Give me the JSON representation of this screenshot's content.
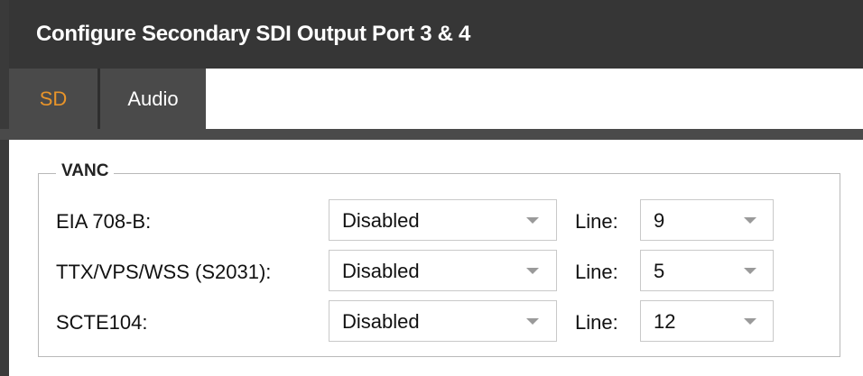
{
  "dialog": {
    "title": "Configure Secondary SDI Output Port 3 & 4"
  },
  "tabs": [
    {
      "label": "SD",
      "active": true
    },
    {
      "label": "Audio",
      "active": false
    }
  ],
  "vanc": {
    "legend": "VANC",
    "line_label": "Line:",
    "rows": [
      {
        "label": "EIA 708-B:",
        "mode": "Disabled",
        "line": "9"
      },
      {
        "label": "TTX/VPS/WSS (S2031):",
        "mode": "Disabled",
        "line": "5"
      },
      {
        "label": "SCTE104:",
        "mode": "Disabled",
        "line": "12"
      }
    ]
  },
  "icons": {
    "dropdown": "chevron-down-icon"
  },
  "colors": {
    "title_bar": "#363636",
    "tab_bg": "#4a4a4a",
    "active_tab_text": "#e8942a",
    "inactive_tab_text": "#ffffff"
  }
}
